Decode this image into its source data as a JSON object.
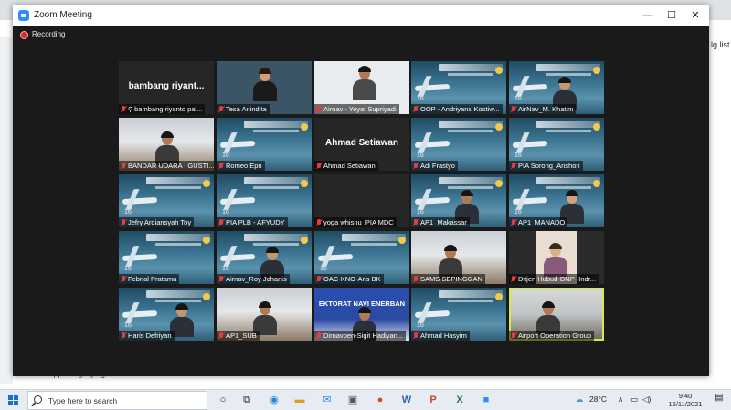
{
  "window": {
    "title": "Zoom Meeting",
    "minimize": "—",
    "maximize": "☐",
    "close": "✕",
    "recording_label": "Recording"
  },
  "background": {
    "right_text": "lg list",
    "bottom_text": "whatsapp image.jpeg"
  },
  "participants": [
    {
      "name": "bambang riyanto pal...",
      "display": "bambang riyant...",
      "kind": "name",
      "pinned": true
    },
    {
      "name": "Tesa Anindita",
      "kind": "person"
    },
    {
      "name": "Airnav - Yoyat Supriyadi",
      "kind": "person"
    },
    {
      "name": "OOP - Andriyana Kostiw...",
      "kind": "slide"
    },
    {
      "name": "AirNav_M. Khatim",
      "kind": "slide-person"
    },
    {
      "name": "BANDAR UDARA I GUSTI...",
      "kind": "room"
    },
    {
      "name": "Romeo Epn",
      "kind": "slide"
    },
    {
      "name": "Ahmad Setiawan",
      "display": "Ahmad Setiawan",
      "kind": "name"
    },
    {
      "name": "Adi Frastyo",
      "kind": "slide"
    },
    {
      "name": "PIA Sorong_Anshori",
      "kind": "slide"
    },
    {
      "name": "Jefry Ardiansyah Toy",
      "kind": "slide"
    },
    {
      "name": "PIA PLB - AFYUDY",
      "kind": "slide"
    },
    {
      "name": "yoga whisnu_PIA MDC",
      "kind": "black"
    },
    {
      "name": "AP1_Makassar",
      "kind": "slide-person"
    },
    {
      "name": "AP1_MANADO",
      "kind": "slide-person"
    },
    {
      "name": "Febrial Pratama",
      "kind": "slide"
    },
    {
      "name": "Airnav_Roy Johanis",
      "kind": "slide-person"
    },
    {
      "name": "OAC-KNO-Aris BK",
      "kind": "slide"
    },
    {
      "name": "SAMS SEPINGGAN",
      "kind": "room"
    },
    {
      "name": "Ditjen Hubud-DNP- Indr...",
      "kind": "person"
    },
    {
      "name": "Haris Defriyan",
      "kind": "slide-person"
    },
    {
      "name": "AP1_SUB",
      "kind": "room"
    },
    {
      "name": "Dirnavpen-Sigit Hadiyan...",
      "kind": "banner",
      "banner_text": "EKTORAT NAVI    ENERBAN"
    },
    {
      "name": "Ahmad Hasyim",
      "kind": "slide"
    },
    {
      "name": "Airport Operation Group",
      "kind": "room",
      "active": true
    }
  ],
  "taskbar": {
    "search_placeholder": "Type here to search",
    "weather": "28°C",
    "language": "ENG",
    "time": "9:40",
    "date": "16/11/2021"
  },
  "colors": {
    "active_speaker": "#d7e84a",
    "muted_icon": "#e83b3b",
    "zoom_blue": "#2d8cff"
  }
}
